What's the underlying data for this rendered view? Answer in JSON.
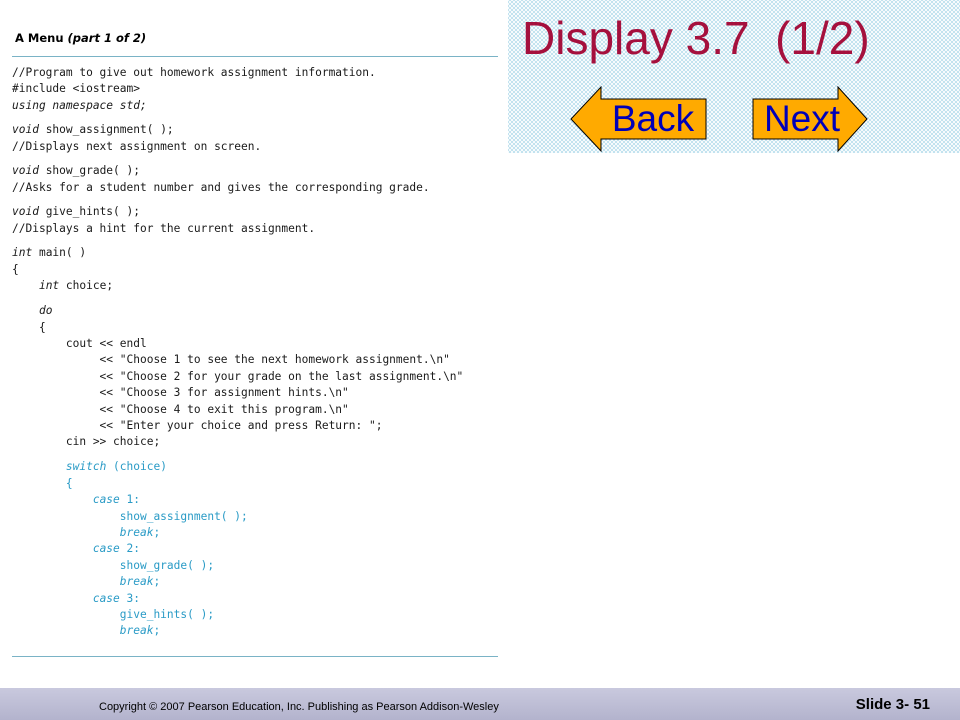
{
  "slide": {
    "title": "Display 3.7  (1/2)",
    "nav": {
      "back_label": "Back",
      "next_label": "Next"
    },
    "colors": {
      "title": "#a5103d",
      "nav_fill": "#ffaa00",
      "nav_text": "#0000b8",
      "header_bg": "#c3e3ef",
      "code_highlight": "#2a9bc6",
      "footer_bg": "#b9b9d2"
    }
  },
  "code_panel": {
    "caption_prefix": "A Menu ",
    "caption_part": "(part 1 of 2)",
    "lines": [
      [
        {
          "t": "//Program to give out homework assignment information."
        }
      ],
      [
        {
          "t": "#include <iostream>"
        }
      ],
      [
        {
          "t": "using namespace std;",
          "k": "it"
        }
      ],
      [
        {
          "t": "void",
          "k": "it"
        },
        {
          "t": " show_assignment( );"
        }
      ],
      [
        {
          "t": "//Displays next assignment on screen."
        }
      ],
      [
        {
          "t": "void",
          "k": "it"
        },
        {
          "t": " show_grade( );"
        }
      ],
      [
        {
          "t": "//Asks for a student number and gives the corresponding grade."
        }
      ],
      [
        {
          "t": "void",
          "k": "it"
        },
        {
          "t": " give_hints( );"
        }
      ],
      [
        {
          "t": "//Displays a hint for the current assignment."
        }
      ],
      [
        {
          "t": "int",
          "k": "it"
        },
        {
          "t": " main( )"
        }
      ],
      [
        {
          "t": "{"
        }
      ],
      [
        {
          "t": "    "
        },
        {
          "t": "int",
          "k": "it"
        },
        {
          "t": " choice;"
        }
      ],
      [
        {
          "t": "    "
        },
        {
          "t": "do",
          "k": "it"
        }
      ],
      [
        {
          "t": "    {"
        }
      ],
      [
        {
          "t": "        cout << endl"
        }
      ],
      [
        {
          "t": "             << \"Choose 1 to see the next homework assignment.\\n\""
        }
      ],
      [
        {
          "t": "             << \"Choose 2 for your grade on the last assignment.\\n\""
        }
      ],
      [
        {
          "t": "             << \"Choose 3 for assignment hints.\\n\""
        }
      ],
      [
        {
          "t": "             << \"Choose 4 to exit this program.\\n\""
        }
      ],
      [
        {
          "t": "             << \"Enter your choice and press Return: \";"
        }
      ],
      [
        {
          "t": "        cin >> choice;"
        }
      ],
      [
        {
          "t": "        "
        },
        {
          "t": "switch",
          "k": "it"
        },
        {
          "t": " (choice)"
        }
      ],
      [
        {
          "t": "        {"
        }
      ],
      [
        {
          "t": "            "
        },
        {
          "t": "case",
          "k": "it"
        },
        {
          "t": " 1:"
        }
      ],
      [
        {
          "t": "                show_assignment( );"
        }
      ],
      [
        {
          "t": "                "
        },
        {
          "t": "break",
          "k": "it"
        },
        {
          "t": ";"
        }
      ],
      [
        {
          "t": "            "
        },
        {
          "t": "case",
          "k": "it"
        },
        {
          "t": " 2:"
        }
      ],
      [
        {
          "t": "                show_grade( );"
        }
      ],
      [
        {
          "t": "                "
        },
        {
          "t": "break",
          "k": "it"
        },
        {
          "t": ";"
        }
      ],
      [
        {
          "t": "            "
        },
        {
          "t": "case",
          "k": "it"
        },
        {
          "t": " 3:"
        }
      ],
      [
        {
          "t": "                give_hints( );"
        }
      ],
      [
        {
          "t": "                "
        },
        {
          "t": "break",
          "k": "it"
        },
        {
          "t": ";"
        }
      ]
    ]
  },
  "footer": {
    "copyright": "Copyright © 2007 Pearson Education, Inc. Publishing as Pearson Addison-Wesley",
    "slide_number": "Slide 3- 51"
  }
}
